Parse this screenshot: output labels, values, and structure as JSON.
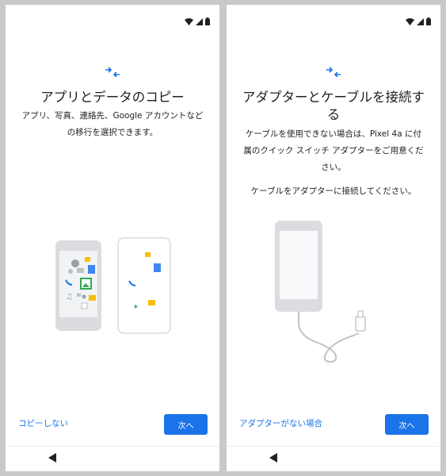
{
  "left": {
    "title": "アプリとデータのコピー",
    "description_lines": [
      "アプリ、写真、連絡先、Google アカウントなど",
      "の移行を選択できます。"
    ],
    "skip_button": "コピーしない",
    "next_button": "次へ"
  },
  "right": {
    "title_lines": [
      "アダプターとケーブルを接続す",
      "る"
    ],
    "description_lines": [
      "ケーブルを使用できない場合は、Pixel 4a に付",
      "属のクイック スイッチ アダプターをご用意くだ",
      "さい。"
    ],
    "instruction": "ケーブルをアダプターに接続してください。",
    "no_adapter_button": "アダプターがない場合",
    "next_button": "次へ"
  },
  "colors": {
    "accent": "#1a73e8",
    "background": "#ffffff",
    "frame": "#c9c9c9"
  },
  "icons": [
    "wifi-icon",
    "signal-icon",
    "battery-icon",
    "transfer-arrows-icon",
    "back-icon"
  ]
}
